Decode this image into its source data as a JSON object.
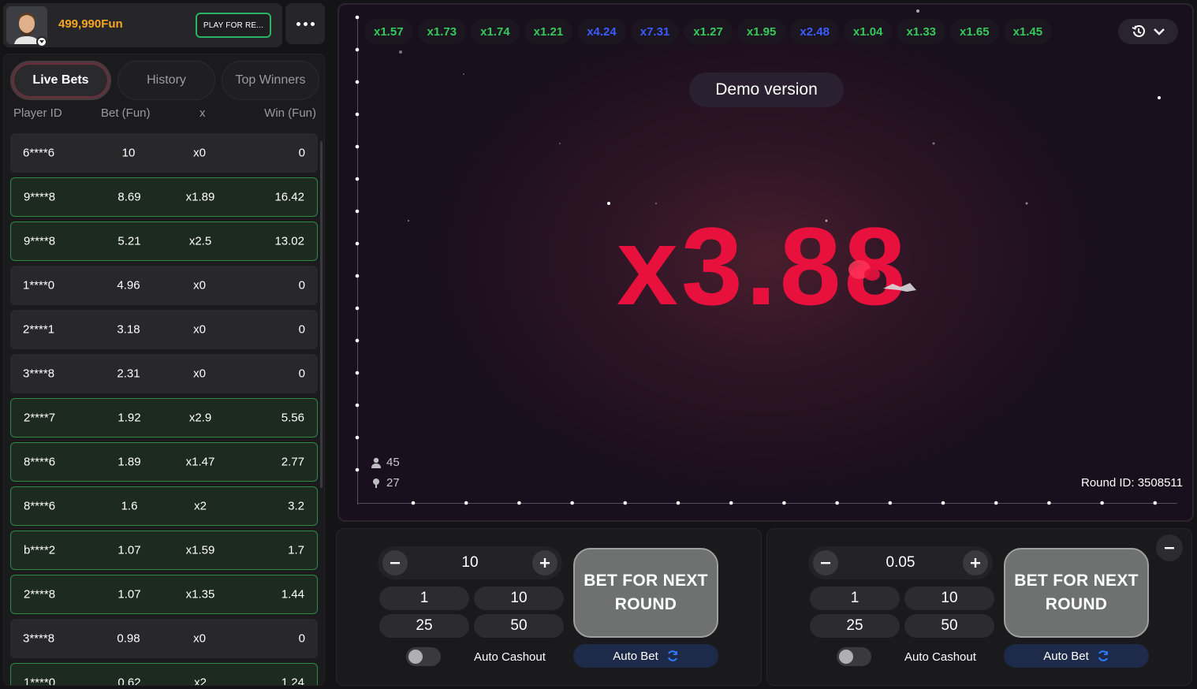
{
  "header": {
    "balance": "499,990Fun",
    "play_real_label": "PLAY FOR RE..."
  },
  "bets_panel": {
    "tabs": [
      {
        "label": "Live Bets",
        "active": true
      },
      {
        "label": "History",
        "active": false
      },
      {
        "label": "Top Winners",
        "active": false
      }
    ],
    "columns": {
      "player": "Player ID",
      "bet": "Bet (Fun)",
      "mult": "x",
      "win": "Win (Fun)"
    },
    "rows": [
      {
        "player": "6****6",
        "bet": "10",
        "mult": "x0",
        "win": "0",
        "won": false
      },
      {
        "player": "9****8",
        "bet": "8.69",
        "mult": "x1.89",
        "win": "16.42",
        "won": true
      },
      {
        "player": "9****8",
        "bet": "5.21",
        "mult": "x2.5",
        "win": "13.02",
        "won": true
      },
      {
        "player": "1****0",
        "bet": "4.96",
        "mult": "x0",
        "win": "0",
        "won": false
      },
      {
        "player": "2****1",
        "bet": "3.18",
        "mult": "x0",
        "win": "0",
        "won": false
      },
      {
        "player": "3****8",
        "bet": "2.31",
        "mult": "x0",
        "win": "0",
        "won": false
      },
      {
        "player": "2****7",
        "bet": "1.92",
        "mult": "x2.9",
        "win": "5.56",
        "won": true
      },
      {
        "player": "8****6",
        "bet": "1.89",
        "mult": "x1.47",
        "win": "2.77",
        "won": true
      },
      {
        "player": "8****6",
        "bet": "1.6",
        "mult": "x2",
        "win": "3.2",
        "won": true
      },
      {
        "player": "b****2",
        "bet": "1.07",
        "mult": "x1.59",
        "win": "1.7",
        "won": true
      },
      {
        "player": "2****8",
        "bet": "1.07",
        "mult": "x1.35",
        "win": "1.44",
        "won": true
      },
      {
        "player": "3****8",
        "bet": "0.98",
        "mult": "x0",
        "win": "0",
        "won": false
      },
      {
        "player": "1****0",
        "bet": "0.62",
        "mult": "x2",
        "win": "1.24",
        "won": true
      }
    ]
  },
  "game": {
    "history": [
      {
        "value": "x1.57",
        "color": "green"
      },
      {
        "value": "x1.73",
        "color": "green"
      },
      {
        "value": "x1.74",
        "color": "green"
      },
      {
        "value": "x1.21",
        "color": "green"
      },
      {
        "value": "x4.24",
        "color": "blue"
      },
      {
        "value": "x7.31",
        "color": "blue"
      },
      {
        "value": "x1.27",
        "color": "green"
      },
      {
        "value": "x1.95",
        "color": "green"
      },
      {
        "value": "x2.48",
        "color": "blue"
      },
      {
        "value": "x1.04",
        "color": "green"
      },
      {
        "value": "x1.33",
        "color": "green"
      },
      {
        "value": "x1.65",
        "color": "green"
      },
      {
        "value": "x1.45",
        "color": "green"
      }
    ],
    "demo_label": "Demo version",
    "multiplier": "x3.88",
    "players_count": "45",
    "bettors_count": "27",
    "round_id_label": "Round ID:",
    "round_id": "3508511",
    "colors": {
      "multiplier": "#e8113d",
      "green": "#36c95a",
      "blue": "#3b5bff"
    }
  },
  "bet_controls": [
    {
      "amount": "10",
      "quick": [
        "1",
        "10",
        "25",
        "50"
      ],
      "auto_cashout_label": "Auto Cashout",
      "bet_label": "BET FOR NEXT ROUND",
      "auto_bet_label": "Auto Bet",
      "auto_cashout_enabled": false
    },
    {
      "amount": "0.05",
      "quick": [
        "1",
        "10",
        "25",
        "50"
      ],
      "auto_cashout_label": "Auto Cashout",
      "bet_label": "BET FOR NEXT ROUND",
      "auto_bet_label": "Auto Bet",
      "auto_cashout_enabled": false
    }
  ]
}
